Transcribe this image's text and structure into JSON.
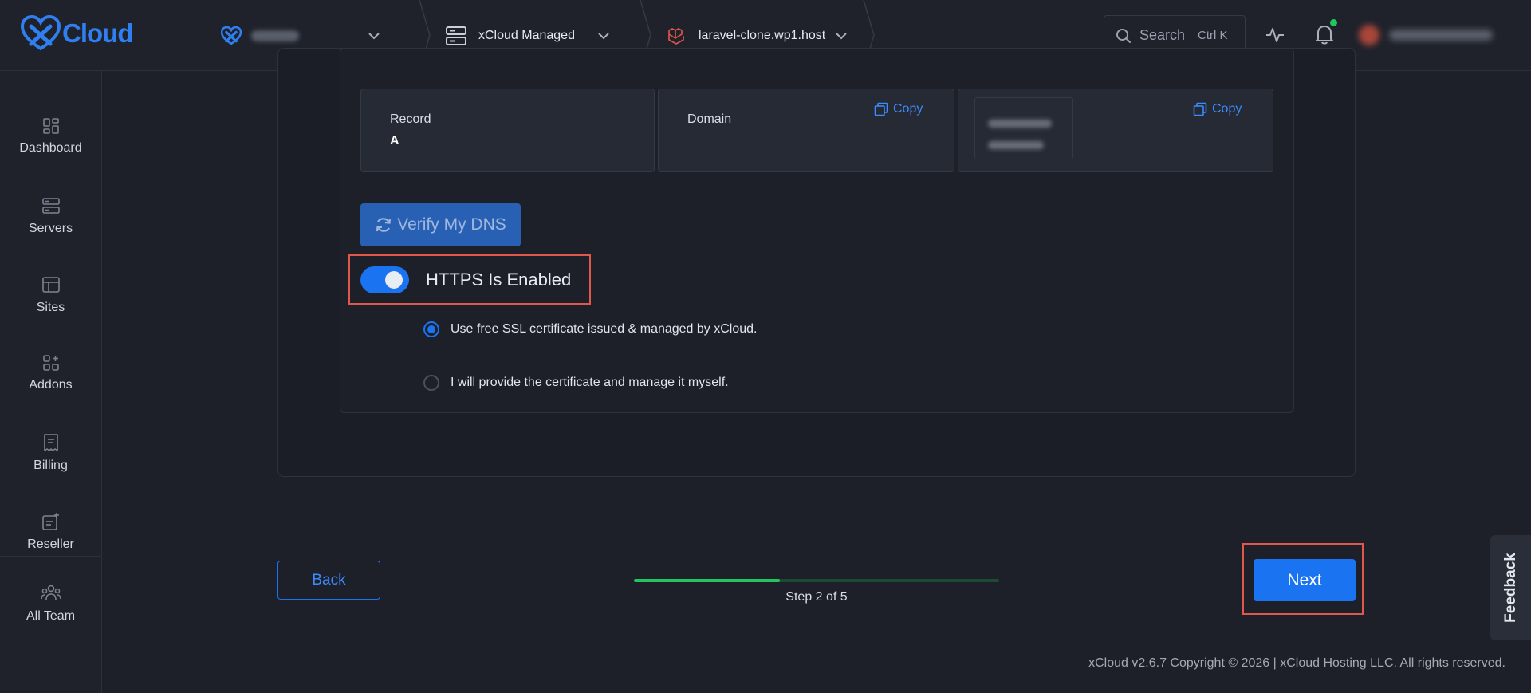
{
  "brand": {
    "name": "Cloud",
    "accent": "#1a73f0"
  },
  "header": {
    "crumbs": [
      {
        "label": "",
        "icon": "xcloud-logo-icon"
      },
      {
        "label": "xCloud Managed",
        "icon": "server-icon"
      },
      {
        "label": "laravel-clone.wp1.host",
        "icon": "laravel-icon"
      }
    ],
    "search": {
      "label": "Search",
      "shortcut": "Ctrl K"
    },
    "icons": [
      "activity-icon",
      "bell-icon"
    ],
    "notification_status_color": "#22c55e"
  },
  "sidebar": {
    "items": [
      {
        "label": "Dashboard",
        "icon": "dashboard-icon"
      },
      {
        "label": "Servers",
        "icon": "server-icon"
      },
      {
        "label": "Sites",
        "icon": "sites-icon"
      },
      {
        "label": "Addons",
        "icon": "addons-icon"
      },
      {
        "label": "Billing",
        "icon": "billing-icon"
      },
      {
        "label": "Reseller",
        "icon": "reseller-icon"
      },
      {
        "label": "All Team",
        "icon": "team-icon"
      }
    ]
  },
  "dns": {
    "record": {
      "title": "Record",
      "value": "A"
    },
    "domain": {
      "title": "Domain",
      "copy_label": "Copy"
    },
    "ip": {
      "copy_label": "Copy"
    },
    "verify_label": "Verify My DNS"
  },
  "https": {
    "label": "HTTPS Is Enabled",
    "enabled": true,
    "options": [
      {
        "label": "Use free SSL certificate issued & managed by xCloud.",
        "selected": true
      },
      {
        "label": "I will provide the certificate and manage it myself.",
        "selected": false
      }
    ]
  },
  "wizard": {
    "back_label": "Back",
    "next_label": "Next",
    "step_label": "Step 2 of 5",
    "progress": 0.4,
    "progress_color": "#22c55e"
  },
  "footer": {
    "copyright": "xCloud v2.6.7 Copyright © 2026 | xCloud Hosting LLC. All rights reserved."
  },
  "feedback": {
    "label": "Feedback"
  }
}
